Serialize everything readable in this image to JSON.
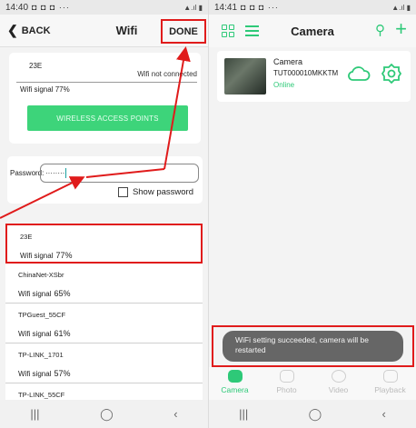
{
  "left": {
    "status": {
      "time": "14:40",
      "dots": "◘ ◘ ◘ ···",
      "signal": "▲.ıl ▮"
    },
    "topbar": {
      "back_label": "BACK",
      "title": "Wifi",
      "done_label": "DONE"
    },
    "current_network": {
      "ssid": "23E",
      "status": "Wifi not connected",
      "signal_label": "Wifi signal",
      "signal_value": "77%",
      "button_label": "WIRELESS ACCESS POINTS"
    },
    "password": {
      "label": "Password:",
      "value": "········",
      "show_label": "Show password"
    },
    "networks": [
      {
        "ssid": "23E",
        "signal_label": "Wifi signal",
        "signal_value": "77%"
      },
      {
        "ssid": "ChinaNet-XSbr",
        "signal_label": "Wifi signal",
        "signal_value": "65%"
      },
      {
        "ssid": "TPGuest_55CF",
        "signal_label": "Wifi signal",
        "signal_value": "61%"
      },
      {
        "ssid": "TP-LINK_1701",
        "signal_label": "Wifi signal",
        "signal_value": "57%"
      },
      {
        "ssid": "TP-LINK_55CF",
        "signal_label": "",
        "signal_value": ""
      }
    ],
    "nav": {
      "recent": "|||",
      "home": "◯",
      "back": "‹"
    }
  },
  "right": {
    "status": {
      "time": "14:41",
      "dots": "◘ ◘ ◘ ···",
      "signal": "▲.ıl ▮"
    },
    "topbar": {
      "title": "Camera"
    },
    "camera": {
      "name": "Camera",
      "id": "TUT000010MKKTM",
      "state": "Online"
    },
    "toast": "WiFi setting succeeded, camera will be restarted",
    "tabs": [
      {
        "label": "Camera",
        "active": true
      },
      {
        "label": "Photo",
        "active": false
      },
      {
        "label": "Video",
        "active": false
      },
      {
        "label": "Playback",
        "active": false
      }
    ],
    "nav": {
      "recent": "|||",
      "home": "◯",
      "back": "‹"
    }
  },
  "colors": {
    "accent_green": "#2ec978",
    "button_green": "#3dd47a",
    "annotation_red": "#e01b1b"
  }
}
